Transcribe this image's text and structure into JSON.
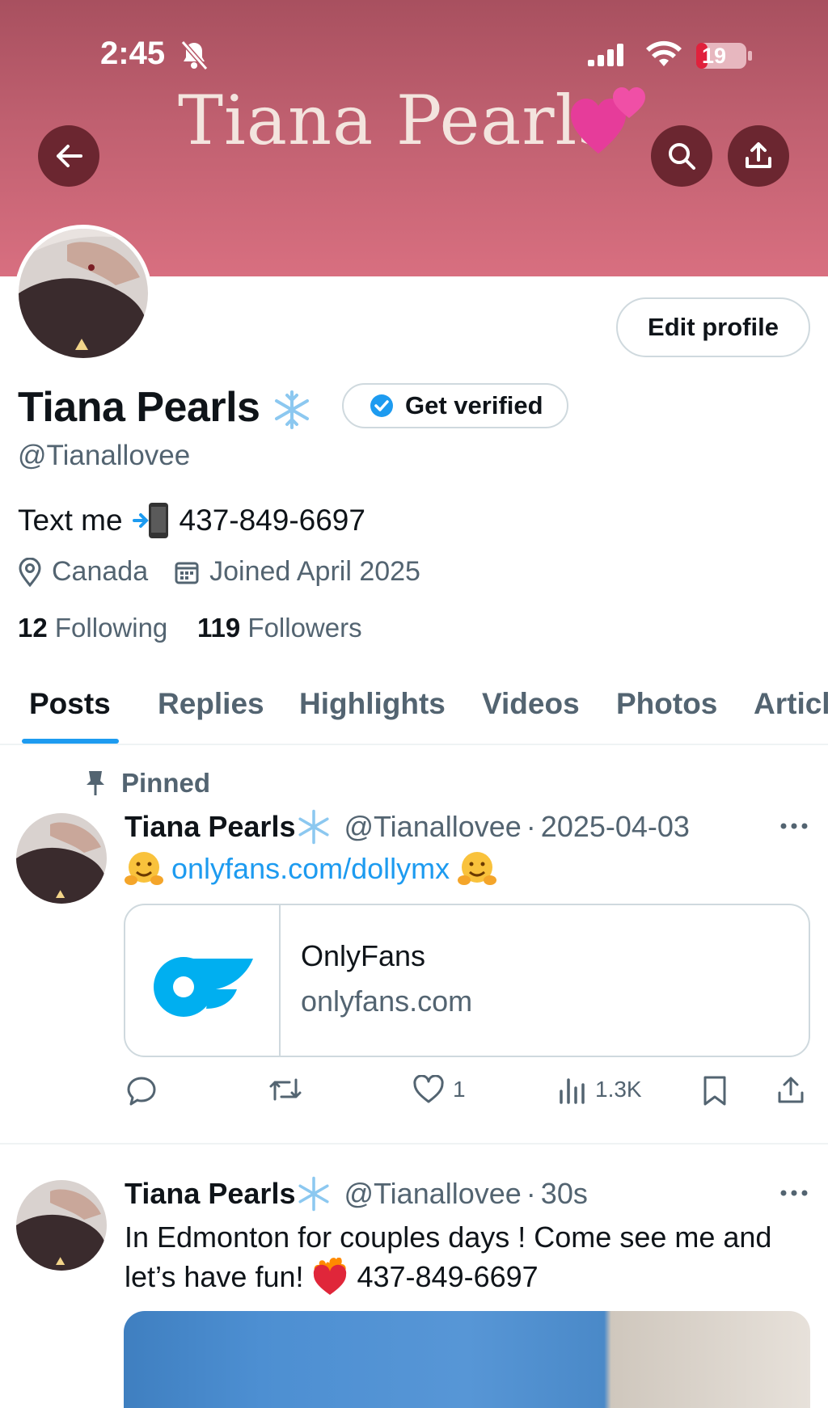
{
  "status_bar": {
    "time": "2:45",
    "battery": "19"
  },
  "header": {
    "banner_title": "Tiana Pearls"
  },
  "profile": {
    "edit_label": "Edit profile",
    "name": "Tiana Pearls",
    "get_verified_label": "Get verified",
    "handle": "@Tianallovee",
    "bio_prefix": "Text me",
    "bio_phone": "437-849-6697",
    "location": "Canada",
    "joined": "Joined April 2025",
    "following_count": "12",
    "following_label": "Following",
    "followers_count": "119",
    "followers_label": "Followers"
  },
  "tabs": [
    {
      "label": "Posts"
    },
    {
      "label": "Replies"
    },
    {
      "label": "Highlights"
    },
    {
      "label": "Videos"
    },
    {
      "label": "Photos"
    },
    {
      "label": "Articles"
    }
  ],
  "posts": [
    {
      "pinned_label": "Pinned",
      "author": "Tiana Pearls",
      "handle": "@Tianallovee",
      "sep": "·",
      "time": "2025-04-03",
      "link_text": "onlyfans.com/dollymx",
      "card_title": "OnlyFans",
      "card_domain": "onlyfans.com",
      "likes": "1",
      "views": "1.3K"
    },
    {
      "author": "Tiana Pearls",
      "handle": "@Tianallovee",
      "sep": "·",
      "time": "30s",
      "text_line1": "In Edmonton for couples days ! Come see me and",
      "text_line2_a": "let’s have fun!",
      "text_line2_b": "437-849-6697"
    }
  ],
  "colors": {
    "accent": "#1d9bf0",
    "banner": "#c06070",
    "button_dark": "#6b2630",
    "text_secondary": "#536471"
  },
  "icons": [
    "back-arrow-icon",
    "search-icon",
    "share-icon",
    "bell-slash-icon",
    "verified-badge-icon",
    "location-icon",
    "calendar-icon",
    "pin-icon",
    "reply-icon",
    "retweet-icon",
    "like-icon",
    "views-icon",
    "bookmark-icon",
    "more-icon"
  ]
}
